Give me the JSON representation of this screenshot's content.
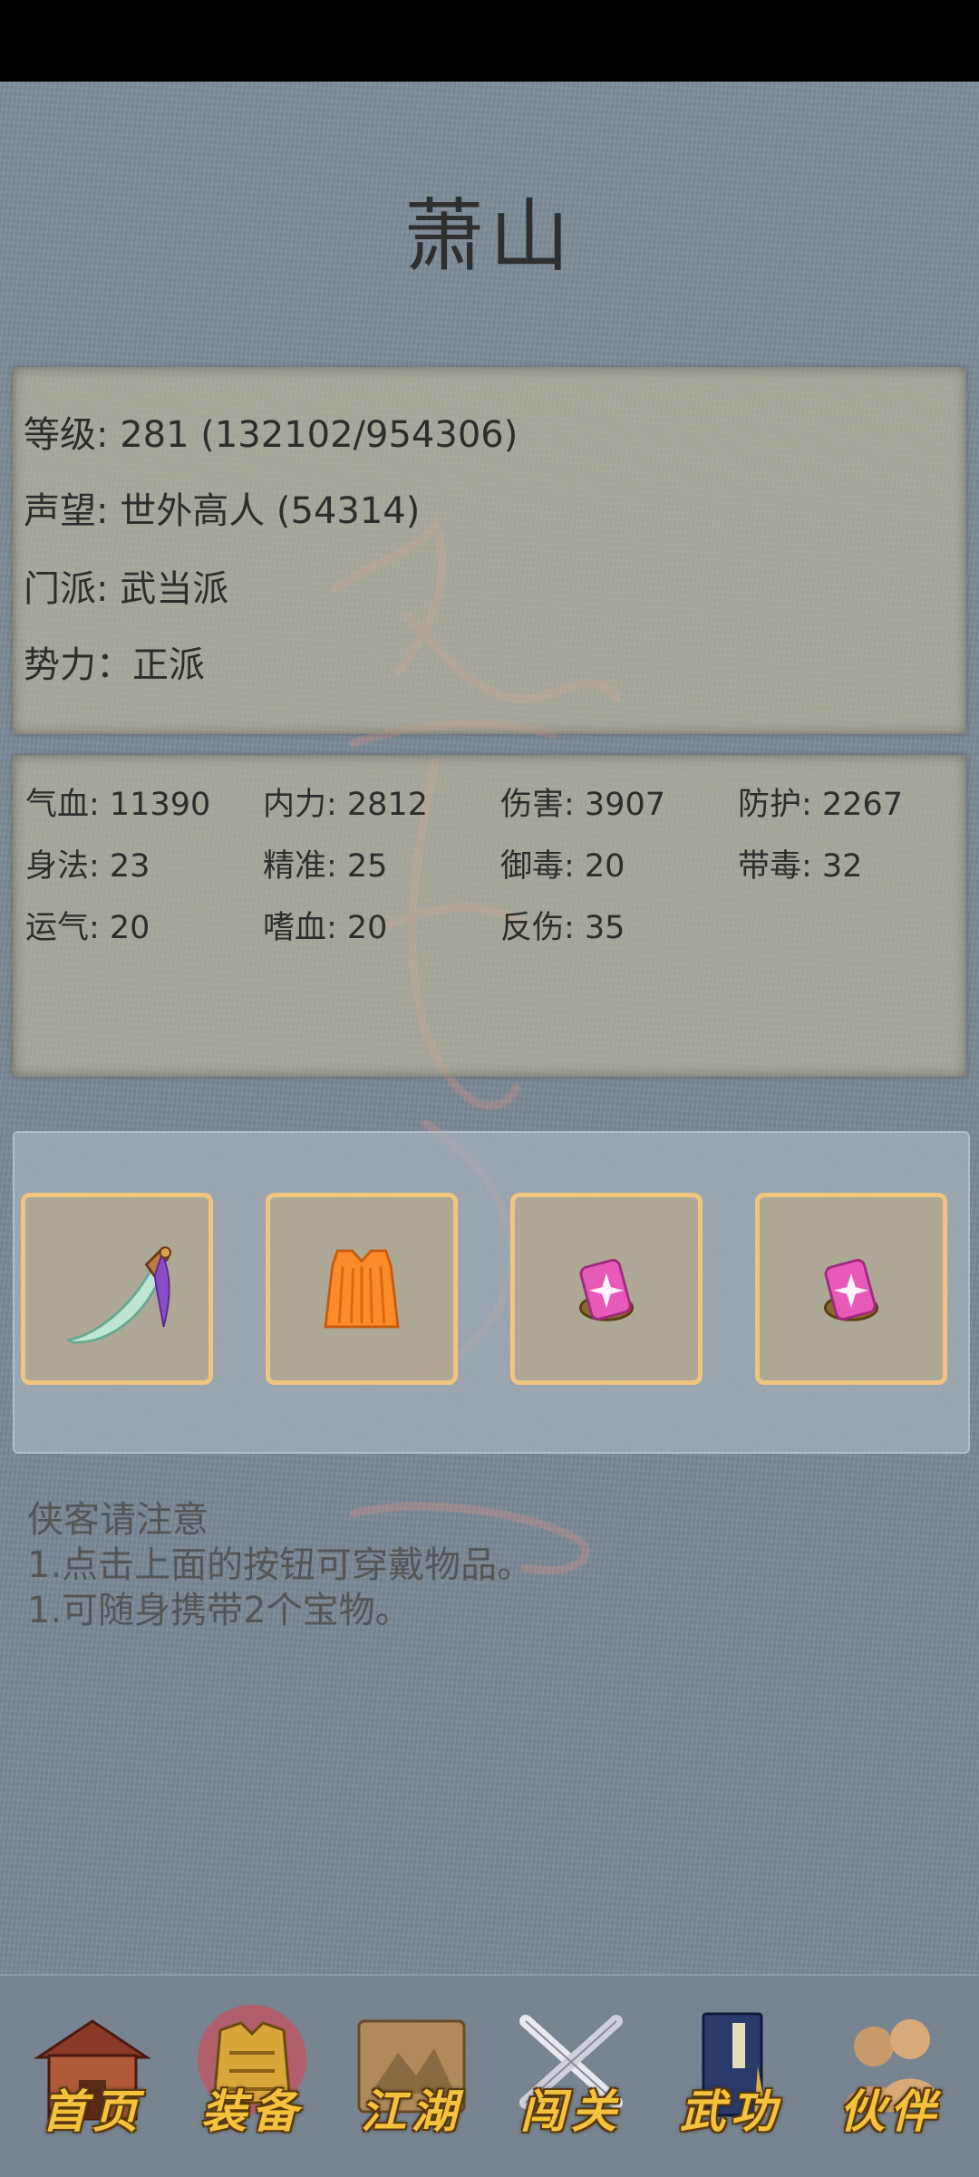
{
  "character": {
    "name": "萧山"
  },
  "info": {
    "level": "等级: 281 (132102/954306)",
    "reputation": "声望: 世外高人 (54314)",
    "sect": "门派: 武当派",
    "faction": "势力：正派"
  },
  "stats": [
    "气血: 11390",
    "内力: 2812",
    "伤害: 3907",
    "防护: 2267",
    "身法: 23",
    "精准: 25",
    "御毒: 20",
    "带毒: 32",
    "运气: 20",
    "嗜血: 20",
    "反伤: 35"
  ],
  "equipment": [
    {
      "icon": "machete-icon"
    },
    {
      "icon": "robe-icon"
    },
    {
      "icon": "gem-treasure-icon"
    },
    {
      "icon": "gem-treasure-icon"
    }
  ],
  "notes": {
    "title": "侠客请注意",
    "line1": "1.点击上面的按钮可穿戴物品。",
    "line2": "1.可随身携带2个宝物。"
  },
  "nav": {
    "home": "首页",
    "equipment": "装备",
    "jianghu": "江湖",
    "challenge": "闯关",
    "martial": "武功",
    "partner": "伙伴"
  },
  "colors": {
    "slot_border": "#efc57f",
    "nav_label": "#f4c23c",
    "title": "#2f2f2f"
  }
}
